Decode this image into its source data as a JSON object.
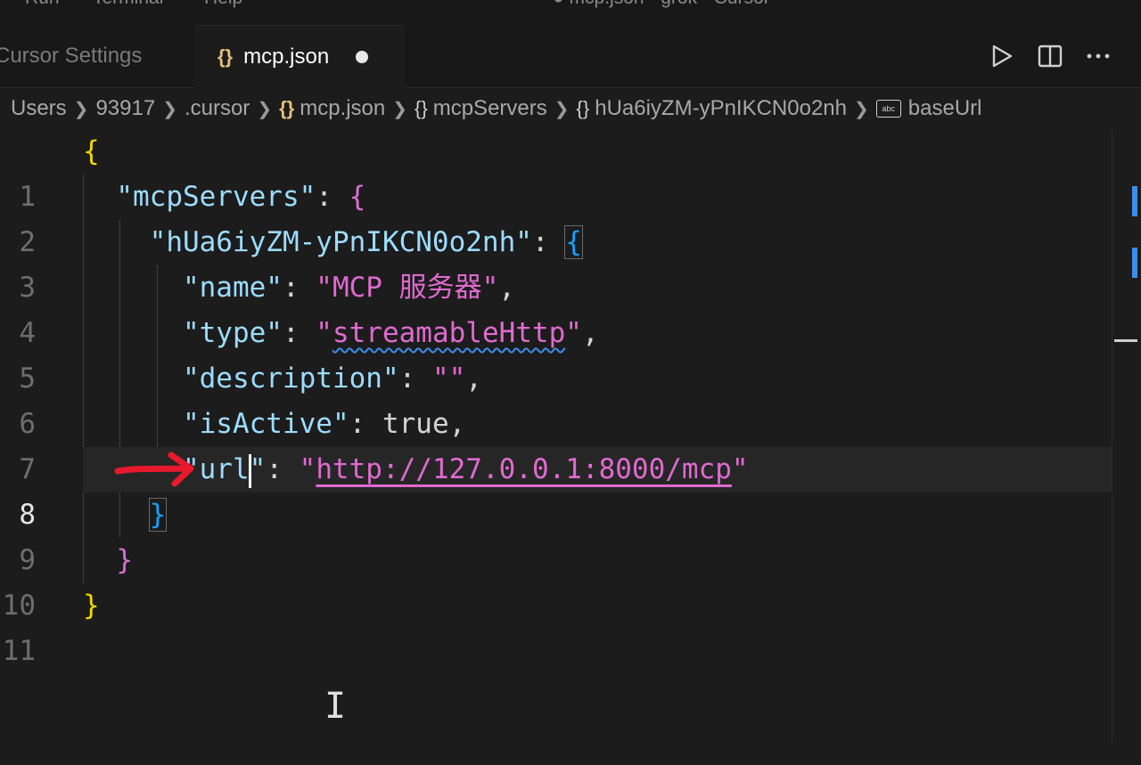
{
  "menu": {
    "items": [
      "Run",
      "Terminal",
      "Help"
    ],
    "title": "● mcp.json - grok - Cursor"
  },
  "tabs": [
    {
      "label": "Cursor Settings",
      "active": false
    },
    {
      "label": "mcp.json",
      "active": true,
      "icon": "json-braces-icon",
      "modified": true
    }
  ],
  "tab_actions": [
    "run-icon",
    "split-editor-icon",
    "more-icon"
  ],
  "breadcrumb": [
    "Users",
    "93917",
    ".cursor",
    "mcp.json",
    "mcpServers",
    "hUa6iyZM-yPnIKCN0o2nh",
    "baseUrl"
  ],
  "editor": {
    "current_line": 8,
    "lines": [
      "1",
      "2",
      "3",
      "4",
      "5",
      "6",
      "7",
      "8",
      "9",
      "10",
      "11"
    ],
    "tokens": {
      "open_brace": "{",
      "close_brace": "}",
      "colon": ": ",
      "comma": ",",
      "key_mcpServers": "\"mcpServers\"",
      "key_server": "\"hUa6iyZM-yPnIKCN0o2nh\"",
      "key_name": "\"name\"",
      "val_name": "\"MCP 服务器\"",
      "key_type": "\"type\"",
      "val_type_q": "\"",
      "val_type": "streamableHttp",
      "key_description": "\"description\"",
      "val_description": "\"\"",
      "key_isActive": "\"isActive\"",
      "val_isActive": "true",
      "key_url_a": "\"url",
      "key_url_b": "\"",
      "val_url": "http://127.0.0.1:8000/mcp",
      "quote": "\""
    }
  },
  "colors": {
    "key": "#9cdcfe",
    "string": "#e06ad0",
    "brace_level1": "#f1d700",
    "brace_level2": "#da70d6",
    "brace_level3": "#179fff",
    "annotation_arrow": "#e8192c"
  }
}
